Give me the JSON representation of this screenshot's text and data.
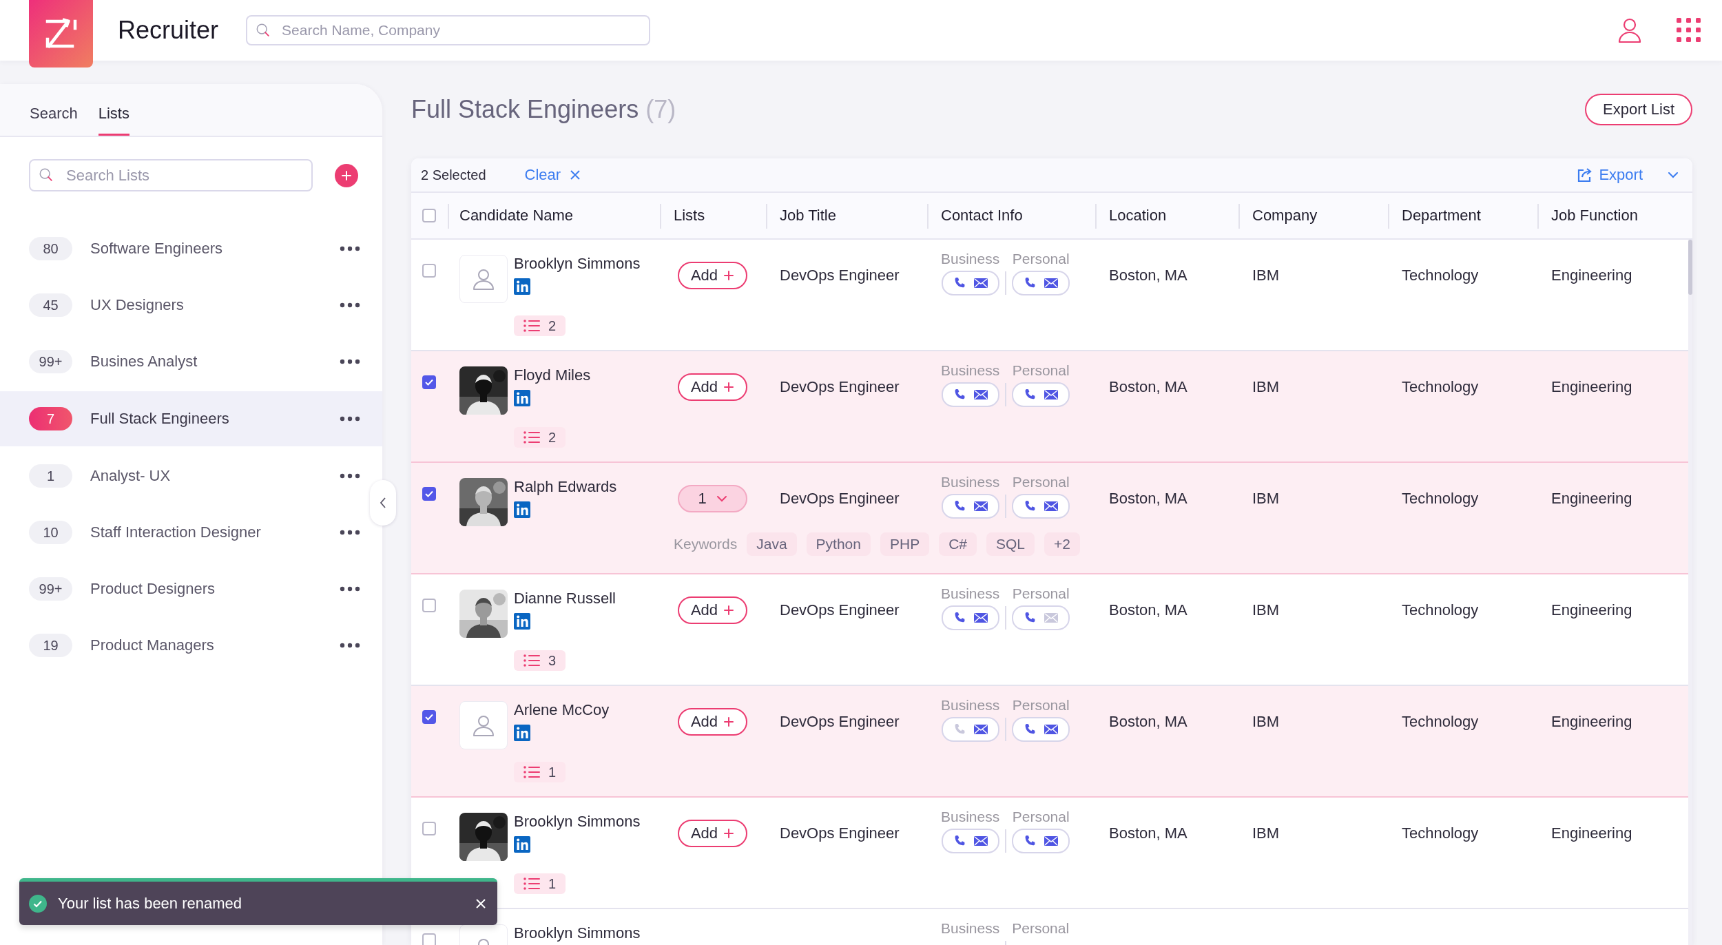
{
  "app": {
    "title": "Recruiter"
  },
  "header": {
    "search": {
      "placeholder": "Search Name, Company"
    }
  },
  "sidebar": {
    "tabs": [
      {
        "label": "Search",
        "selected": false
      },
      {
        "label": "Lists",
        "selected": true
      }
    ],
    "search": {
      "placeholder": "Search Lists"
    },
    "lists": [
      {
        "count": "80",
        "name": "Software Engineers",
        "selected": false
      },
      {
        "count": "45",
        "name": "UX Designers",
        "selected": false
      },
      {
        "count": "99+",
        "name": "Busines Analyst",
        "selected": false
      },
      {
        "count": "7",
        "name": "Full Stack Engineers",
        "selected": true
      },
      {
        "count": "1",
        "name": "Analyst- UX",
        "selected": false
      },
      {
        "count": "10",
        "name": "Staff Interaction Designer",
        "selected": false
      },
      {
        "count": "99+",
        "name": "Product Designers",
        "selected": false
      },
      {
        "count": "19",
        "name": "Product Managers",
        "selected": false
      }
    ]
  },
  "page": {
    "title": "Full Stack Engineers",
    "count": "(7)",
    "export_list_button": "Export List"
  },
  "table": {
    "selected_label": "2 Selected",
    "clear": "Clear",
    "export": "Export",
    "select_all_checked": false,
    "columns": [
      "Candidate Name",
      "Lists",
      "Job Title",
      "Contact Info",
      "Location",
      "Company",
      "Department",
      "Job Function"
    ],
    "rows": [
      {
        "selected": false,
        "avatar": {
          "kind": "placeholder"
        },
        "name": "Brooklyn Simmons",
        "lists": {
          "kind": "add",
          "label": "Add"
        },
        "list_count": "2",
        "job_title": "DevOps Engineer",
        "contact": [
          {
            "label": "Business",
            "phone": true,
            "email": true
          },
          {
            "label": "Personal",
            "phone": true,
            "email": true
          }
        ],
        "location": "Boston, MA",
        "company": "IBM",
        "department": "Technology",
        "job_function": "Engineering"
      },
      {
        "selected": true,
        "name": "Floyd Miles",
        "lists": {
          "kind": "add",
          "label": "Add"
        },
        "list_count": "2",
        "job_title": "DevOps Engineer",
        "contact": [
          {
            "label": "Business",
            "phone": true,
            "email": true
          },
          {
            "label": "Personal",
            "phone": true,
            "email": true
          }
        ],
        "location": "Boston, MA",
        "company": "IBM",
        "department": "Technology",
        "job_function": "Engineering"
      },
      {
        "selected": true,
        "name": "Ralph Edwards",
        "lists": {
          "kind": "dropdown",
          "label": "1"
        },
        "keywords": {
          "label": "Keywords",
          "tags": [
            "Java",
            "Python",
            "PHP",
            "C#",
            "SQL"
          ],
          "more": "+2"
        },
        "job_title": "DevOps Engineer",
        "contact": [
          {
            "label": "Business",
            "phone": true,
            "email": true
          },
          {
            "label": "Personal",
            "phone": true,
            "email": true
          }
        ],
        "location": "Boston, MA",
        "company": "IBM",
        "department": "Technology",
        "job_function": "Engineering"
      },
      {
        "selected": false,
        "name": "Dianne Russell",
        "lists": {
          "kind": "add",
          "label": "Add"
        },
        "list_count": "3",
        "job_title": "DevOps Engineer",
        "contact": [
          {
            "label": "Business",
            "phone": true,
            "email": true
          },
          {
            "label": "Personal",
            "phone": true,
            "email": false
          }
        ],
        "location": "Boston, MA",
        "company": "IBM",
        "department": "Technology",
        "job_function": "Engineering"
      },
      {
        "selected": true,
        "avatar": {
          "kind": "placeholder"
        },
        "name": "Arlene McCoy",
        "lists": {
          "kind": "add",
          "label": "Add"
        },
        "list_count": "1",
        "job_title": "DevOps Engineer",
        "contact": [
          {
            "label": "Business",
            "phone": false,
            "email": true
          },
          {
            "label": "Personal",
            "phone": true,
            "email": true
          }
        ],
        "location": "Boston, MA",
        "company": "IBM",
        "department": "Technology",
        "job_function": "Engineering"
      },
      {
        "selected": false,
        "name": "Brooklyn Simmons",
        "lists": {
          "kind": "add",
          "label": "Add"
        },
        "list_count": "1",
        "job_title": "DevOps Engineer",
        "contact": [
          {
            "label": "Business",
            "phone": true,
            "email": true
          },
          {
            "label": "Personal",
            "phone": true,
            "email": true
          }
        ],
        "location": "Boston, MA",
        "company": "IBM",
        "department": "Technology",
        "job_function": "Engineering"
      },
      {
        "selected": false,
        "avatar": {
          "kind": "placeholder"
        },
        "name": "Brooklyn Simmons",
        "linkedin": false,
        "contact": [
          {
            "label": "Business"
          },
          {
            "label": "Personal"
          }
        ]
      }
    ]
  },
  "toast": {
    "kind": "success",
    "message": "Your list has been renamed"
  }
}
